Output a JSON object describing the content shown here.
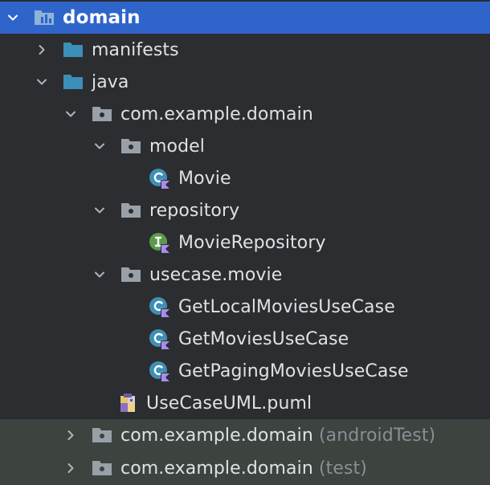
{
  "tree": {
    "root": {
      "label": "domain",
      "expanded": true,
      "icon": "module-folder-icon"
    },
    "manifests": {
      "label": "manifests",
      "expanded": false,
      "icon": "folder-icon"
    },
    "java": {
      "label": "java",
      "expanded": true,
      "icon": "source-folder-icon"
    },
    "pkg_main": {
      "label": "com.example.domain",
      "expanded": true,
      "icon": "package-icon"
    },
    "model": {
      "label": "model",
      "expanded": true,
      "icon": "package-icon"
    },
    "movie": {
      "label": "Movie",
      "icon": "kotlin-class-icon"
    },
    "repository": {
      "label": "repository",
      "expanded": true,
      "icon": "package-icon"
    },
    "movie_repository": {
      "label": "MovieRepository",
      "icon": "kotlin-interface-icon"
    },
    "usecase_movie": {
      "label": "usecase.movie",
      "expanded": true,
      "icon": "package-icon"
    },
    "get_local_movies": {
      "label": "GetLocalMoviesUseCase",
      "icon": "kotlin-class-icon"
    },
    "get_movies": {
      "label": "GetMoviesUseCase",
      "icon": "kotlin-class-icon"
    },
    "get_paging_movies": {
      "label": "GetPagingMoviesUseCase",
      "icon": "kotlin-class-icon"
    },
    "usecase_uml": {
      "label": "UseCaseUML.puml",
      "icon": "plantuml-file-icon"
    },
    "pkg_android_test": {
      "label": "com.example.domain",
      "suffix": "(androidTest)",
      "expanded": false,
      "icon": "package-icon"
    },
    "pkg_test": {
      "label": "com.example.domain",
      "suffix": "(test)",
      "expanded": false,
      "icon": "package-icon"
    }
  },
  "colors": {
    "background": "#2b2d30",
    "selection": "#2f65ca",
    "test_rows": "#3d433f",
    "folder": "#3c8fb8",
    "package": "#9aa0a8",
    "class": "#3f8fb5",
    "interface": "#5b9a4a",
    "kotlin": "#a98cf0",
    "text": "#dfe1e5",
    "muted": "#8b8e94"
  }
}
